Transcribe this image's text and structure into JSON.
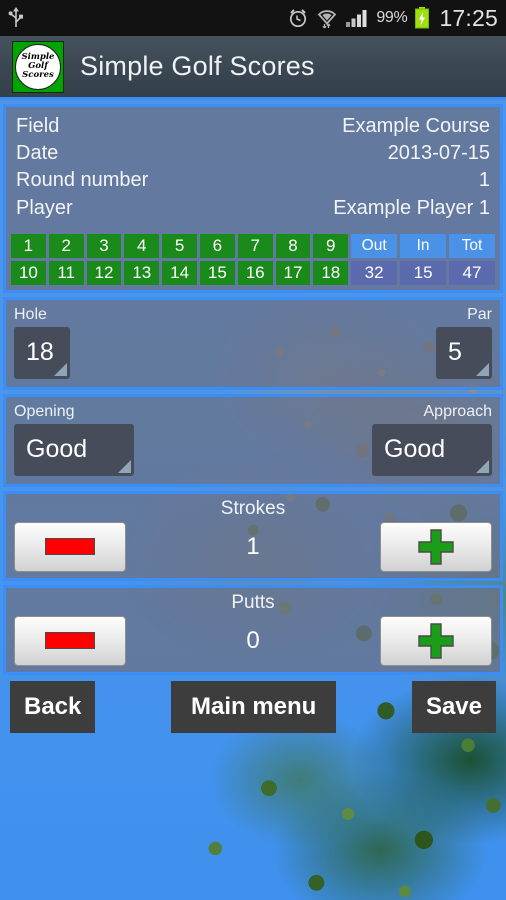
{
  "status_bar": {
    "usb_icon": "usb-icon",
    "alarm_icon": "alarm-clock-icon",
    "wifi_icon": "wifi-icon",
    "signal_icon": "signal-bars-icon",
    "battery_percent": "99%",
    "battery_icon": "battery-charging-icon",
    "clock": "17:25"
  },
  "action_bar": {
    "logo_line1": "Simple",
    "logo_line2": "Golf",
    "logo_line3": "Scores",
    "title": "Simple Golf Scores"
  },
  "info": {
    "rows": [
      {
        "label": "Field",
        "value": "Example Course"
      },
      {
        "label": "Date",
        "value": "2013-07-15"
      },
      {
        "label": "Round number",
        "value": "1"
      },
      {
        "label": "Player",
        "value": "Example Player 1"
      }
    ]
  },
  "holes": {
    "row_front": [
      "1",
      "2",
      "3",
      "4",
      "5",
      "6",
      "7",
      "8",
      "9"
    ],
    "row_back": [
      "10",
      "11",
      "12",
      "13",
      "14",
      "15",
      "16",
      "17",
      "18"
    ],
    "summary_headers": [
      "Out",
      "In",
      "Tot"
    ],
    "summary_values": [
      "32",
      "15",
      "47"
    ]
  },
  "hole_par": {
    "hole_label": "Hole",
    "hole_value": "18",
    "par_label": "Par",
    "par_value": "5"
  },
  "shots": {
    "opening_label": "Opening",
    "opening_value": "Good",
    "approach_label": "Approach",
    "approach_value": "Good"
  },
  "strokes": {
    "label": "Strokes",
    "value": "1",
    "minus_icon": "minus-icon",
    "plus_icon": "plus-icon"
  },
  "putts": {
    "label": "Putts",
    "value": "0",
    "minus_icon": "minus-icon",
    "plus_icon": "plus-icon"
  },
  "bottom": {
    "back": "Back",
    "main_menu": "Main menu",
    "save": "Save"
  },
  "colors": {
    "accent_border": "#3a8ef5",
    "hole_cell": "#1a8a1a",
    "summary_header": "#4a92e8",
    "summary_value": "#5b6aad",
    "minus_red": "#ff0000",
    "plus_green": "#1a9e1a",
    "logo_green": "#00a400"
  }
}
